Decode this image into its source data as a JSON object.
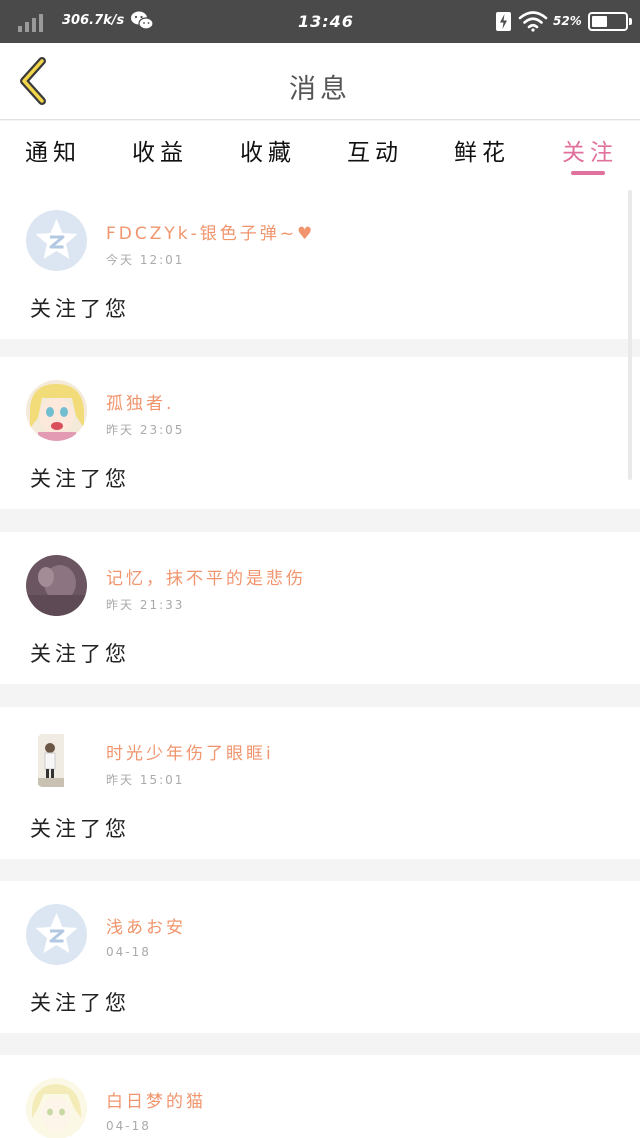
{
  "status_bar": {
    "speed": "306.7k/s",
    "time": "13:46",
    "battery_pct": "52",
    "battery_level": 0.52
  },
  "header": {
    "title": "消息"
  },
  "tabs": [
    {
      "label": "通知",
      "active": false
    },
    {
      "label": "收益",
      "active": false
    },
    {
      "label": "收藏",
      "active": false
    },
    {
      "label": "互动",
      "active": false
    },
    {
      "label": "鲜花",
      "active": false
    },
    {
      "label": "关注",
      "active": true
    }
  ],
  "accent_color": "#e0719c",
  "name_color": "#f0956d",
  "notifications": [
    {
      "name": "FDCZYk-银色子弹~♥",
      "time": "今天 12:01",
      "message": "关注了您",
      "avatar": "qq-default-avatar"
    },
    {
      "name": "孤独者.",
      "time": "昨天 23:05",
      "message": "关注了您",
      "avatar": "anime-girl-avatar"
    },
    {
      "name": "记忆，抹不平的是悲伤",
      "time": "昨天 21:33",
      "message": "关注了您",
      "avatar": "dark-photo-avatar"
    },
    {
      "name": "时光少年伤了眼眶i",
      "time": "昨天 15:01",
      "message": "关注了您",
      "avatar": "boy-photo-avatar"
    },
    {
      "name": "浅あお安",
      "time": "04-18",
      "message": "关注了您",
      "avatar": "qq-default-avatar"
    },
    {
      "name": "白日梦的猫",
      "time": "04-18",
      "message": "",
      "avatar": "pale-girl-avatar"
    }
  ]
}
